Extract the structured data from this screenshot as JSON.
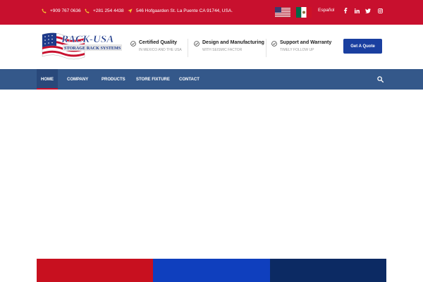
{
  "topbar": {
    "phone1": "+909 767 0636",
    "phone2": "+281 254 4438",
    "address": "546 Hofgaarden St. La Puente CA 91744, USA.",
    "language": "Español",
    "icons": [
      "phone-icon",
      "phone-icon",
      "location-pin-icon",
      "us-flag-icon",
      "mexico-flag-icon",
      "facebook-icon",
      "linkedin-icon",
      "twitter-icon",
      "instagram-icon"
    ]
  },
  "brand": {
    "name": "RACK-USA",
    "tagline": "STORAGE RACK SYSTEMS"
  },
  "features": [
    {
      "title": "Certified Quality",
      "subtitle": "IN MEXICO AND THE USA"
    },
    {
      "title": "Design and Manufacturing",
      "subtitle": "WITH SEISMIC FACTOR"
    },
    {
      "title": "Support and Warranty",
      "subtitle": "TIMELY FOLLOW UP"
    }
  ],
  "cta": {
    "label": "Get A Quote"
  },
  "nav": {
    "items": [
      "HOME",
      "COMPANY",
      "PRODUCTS",
      "STORE FIXTURE",
      "CONTACT"
    ],
    "active": "HOME"
  },
  "colors": {
    "topbar": "#c8102e",
    "nav": "#34588a",
    "button": "#1a3fa0",
    "block_red": "#c8101f",
    "block_blue": "#0f3fbe",
    "block_navy": "#0c2a63"
  }
}
